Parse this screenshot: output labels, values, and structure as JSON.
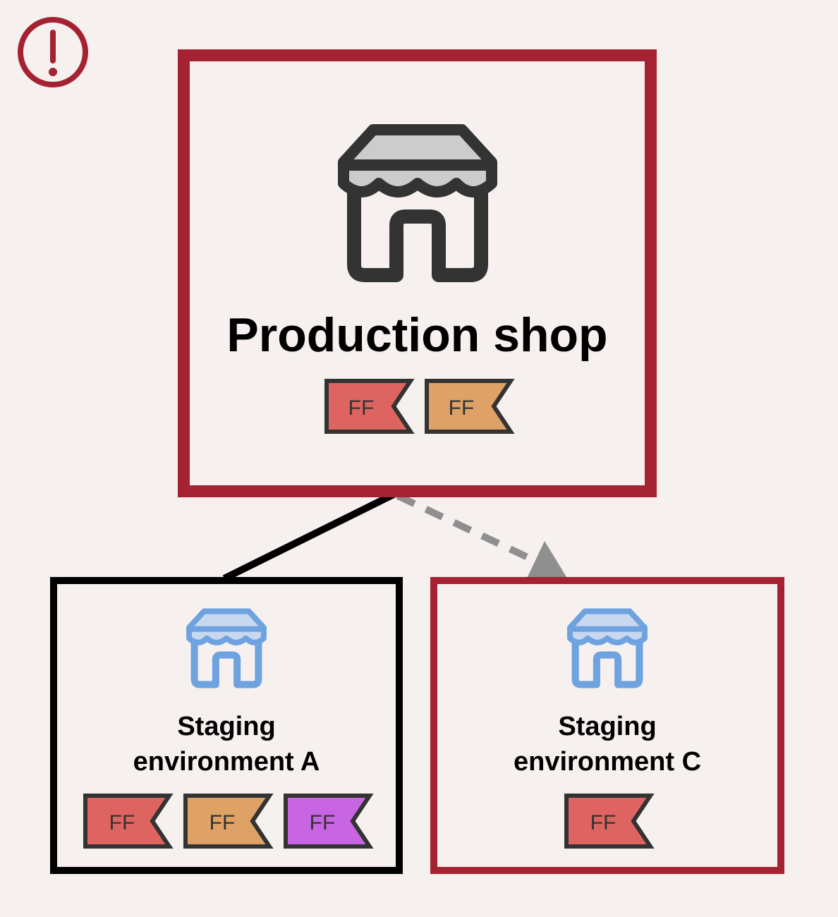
{
  "warning": {
    "icon": "exclamation-circle-icon",
    "color": "#a52232"
  },
  "production": {
    "label": "Production shop",
    "icon": "storefront-icon",
    "flags": [
      {
        "label": "FF",
        "color": "#de6461"
      },
      {
        "label": "FF",
        "color": "#dea266"
      }
    ]
  },
  "staging_a": {
    "label_line1": "Staging",
    "label_line2": "environment A",
    "icon": "storefront-icon",
    "flags": [
      {
        "label": "FF",
        "color": "#de6461"
      },
      {
        "label": "FF",
        "color": "#dea266"
      },
      {
        "label": "FF",
        "color": "#c865e2"
      }
    ]
  },
  "staging_c": {
    "label_line1": "Staging",
    "label_line2": "environment C",
    "icon": "storefront-icon",
    "flags": [
      {
        "label": "FF",
        "color": "#de6461"
      }
    ]
  },
  "colors": {
    "alert_red": "#a52232",
    "store_dark": "#333333",
    "awning_dark": "#cccccc",
    "store_blue": "#6fa3e0",
    "awning_blue": "#c8d8ef",
    "connector_solid": "#000000",
    "connector_dashed": "#8f8f8f"
  }
}
